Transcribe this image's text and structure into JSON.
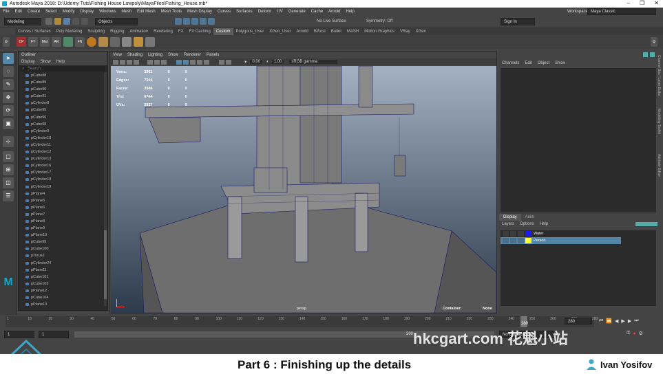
{
  "title_bar": {
    "text": "Autodesk Maya 2018: D:\\Udemy Tuts\\Fishing House Lowpoly\\MayaFiles\\Fishing_House.mb*"
  },
  "window_controls": [
    "–",
    "❐",
    "✕"
  ],
  "menus": [
    "File",
    "Edit",
    "Create",
    "Select",
    "Modify",
    "Display",
    "Windows",
    "Mesh",
    "Edit Mesh",
    "Mesh Tools",
    "Mesh Display",
    "Curves",
    "Surfaces",
    "Deform",
    "UV",
    "Generate",
    "Cache",
    "Arnold",
    "Help"
  ],
  "workspace": {
    "label": "Workspace :",
    "value": "Maya Classic"
  },
  "status_line": {
    "menuset": "Modeling",
    "objects": "Objects",
    "live_surface": "No Live Surface",
    "symmetry": "Symmetry: Off",
    "sign_in": "Sign In"
  },
  "shelf_tabs": [
    "Curves / Surfaces",
    "Poly Modeling",
    "Sculpting",
    "Rigging",
    "Animation",
    "Rendering",
    "FX",
    "FX Caching",
    "Custom",
    "Polygons_User",
    "XGen_User",
    "Arnold",
    "Bifrost",
    "Bullet",
    "MASH",
    "Motion Graphics",
    "VRay",
    "XGen"
  ],
  "shelf_active": "Custom",
  "shelf_icons": [
    "CP",
    "FT",
    "Mat",
    "AR",
    "FN"
  ],
  "outliner": {
    "title": "Outliner",
    "menu": [
      "Display",
      "Show",
      "Help"
    ],
    "search_placeholder": "Search...",
    "items": [
      "pCube88",
      "pCube89",
      "pCube90",
      "pCube91",
      "pCylinder8",
      "pCube95",
      "pCube96",
      "pCube98",
      "pCylinder9",
      "pCylinder10",
      "pCylinder11",
      "pCylinder12",
      "pCylinder13",
      "pCylinder16",
      "pCylinder17",
      "pCylinder18",
      "pCylinder19",
      "pPlane4",
      "pPlane5",
      "pPlane6",
      "pPlane7",
      "pPlane8",
      "pPlane9",
      "pPlane10",
      "pCube99",
      "pCube100",
      "pTorus2",
      "pCylinder24",
      "pPlane11",
      "pCube101",
      "pCube103",
      "pPlane12",
      "pCube104",
      "pPlane13"
    ]
  },
  "viewport": {
    "menu": [
      "View",
      "Shading",
      "Lighting",
      "Show",
      "Renderer",
      "Panels"
    ],
    "exposure": "0.00",
    "gamma": "1.00",
    "color_space": "sRGB gamma",
    "camera": "persp",
    "container_label": "Container:",
    "container_value": "None",
    "hud": [
      {
        "label": "Verts:",
        "a": "3961",
        "b": "0",
        "c": "0"
      },
      {
        "label": "Edges:",
        "a": "7344",
        "b": "0",
        "c": "0"
      },
      {
        "label": "Faces:",
        "a": "3586",
        "b": "0",
        "c": "0"
      },
      {
        "label": "Tris:",
        "a": "6744",
        "b": "0",
        "c": "0"
      },
      {
        "label": "UVs:",
        "a": "5937",
        "b": "0",
        "c": "0"
      }
    ]
  },
  "channel_box": {
    "menu": [
      "Channels",
      "Edit",
      "Object",
      "Show"
    ]
  },
  "layer_editor": {
    "tabs": [
      "Display",
      "Anim"
    ],
    "menu": [
      "Layers",
      "Options",
      "Help"
    ],
    "layers": [
      {
        "name": "Water",
        "color": "#1a1aff",
        "selected": false
      },
      {
        "name": "Person",
        "color": "#ffff33",
        "selected": true
      }
    ]
  },
  "side_tabs": [
    "Channel Box / Layer Editor",
    "Modelling Toolkit",
    "Attribute Editor"
  ],
  "time_slider": {
    "ticks": [
      "1",
      "10",
      "20",
      "30",
      "40",
      "50",
      "60",
      "70",
      "80",
      "90",
      "100",
      "110",
      "120",
      "130",
      "140",
      "150",
      "160",
      "170",
      "180",
      "190",
      "200",
      "210",
      "220",
      "230",
      "240",
      "250",
      "260",
      "270",
      "280"
    ],
    "current": "280",
    "end": "280"
  },
  "range_slider": {
    "start": "1",
    "start2": "1",
    "end_mid": "300",
    "character_set": "No Character Set"
  },
  "bottom": {
    "caption": "Part 6 : Finishing up the details",
    "author": "Ivan Yosifov"
  },
  "watermark": "hkcgart.com 花魁小站",
  "colors": {
    "selection": "#5285a6",
    "maya_logo": "#14a4c8",
    "accent": "#3ea7c9"
  }
}
